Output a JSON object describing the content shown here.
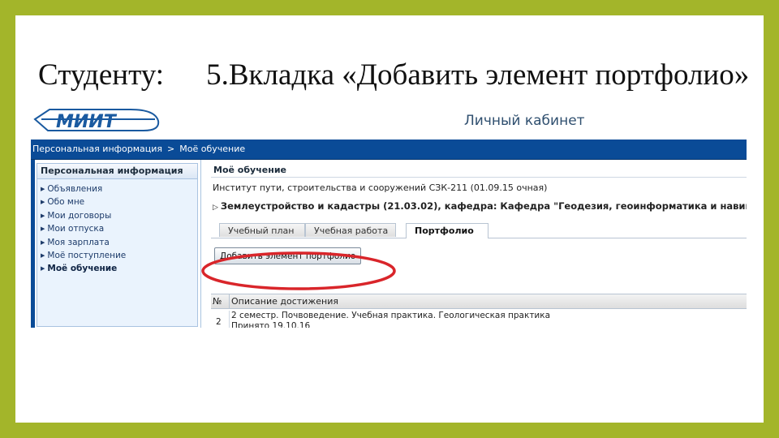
{
  "slide": {
    "title_left": "Студенту:",
    "title_right": "5.Вкладка «Добавить элемент портфолио»"
  },
  "header": {
    "logo_text": "МИИТ",
    "cabinet_title": "Личный кабинет"
  },
  "breadcrumb": {
    "items": [
      "Персональная информация",
      "Моё обучение"
    ],
    "separator": ">"
  },
  "sidebar": {
    "header": "Персональная информация",
    "items": [
      {
        "label": "Объявления"
      },
      {
        "label": "Обо мне"
      },
      {
        "label": "Мои договоры"
      },
      {
        "label": "Мои отпуска"
      },
      {
        "label": "Моя зарплата"
      },
      {
        "label": "Моё поступление"
      },
      {
        "label": "Моё обучение",
        "active": true
      }
    ]
  },
  "main": {
    "section_title": "Моё обучение",
    "institute": "Институт пути, строительства и сооружений СЗК-211 (01.09.15 очная)",
    "specialty": "Землеустройство и кадастры (21.03.02), кафедра: Кафедра \"Геодезия, геоинформатика и навигация\"",
    "tabs": [
      {
        "label": "Учебный план"
      },
      {
        "label": "Учебная работа"
      },
      {
        "label": "Портфолио",
        "active": true
      }
    ],
    "add_button_label": "Добавить элемент портфолио",
    "table": {
      "columns": [
        "№",
        "Описание достижения"
      ],
      "rows": [
        {
          "num": "2",
          "line1": "2 семестр. Почвоведение. Учебная практика. Геологическая практика",
          "line2": "Принято 19.10.16"
        }
      ]
    }
  },
  "colors": {
    "slide_frame": "#a3b52a",
    "navbar": "#0a4b97",
    "highlight": "#d9252a",
    "logo": "#1a5aa0"
  }
}
